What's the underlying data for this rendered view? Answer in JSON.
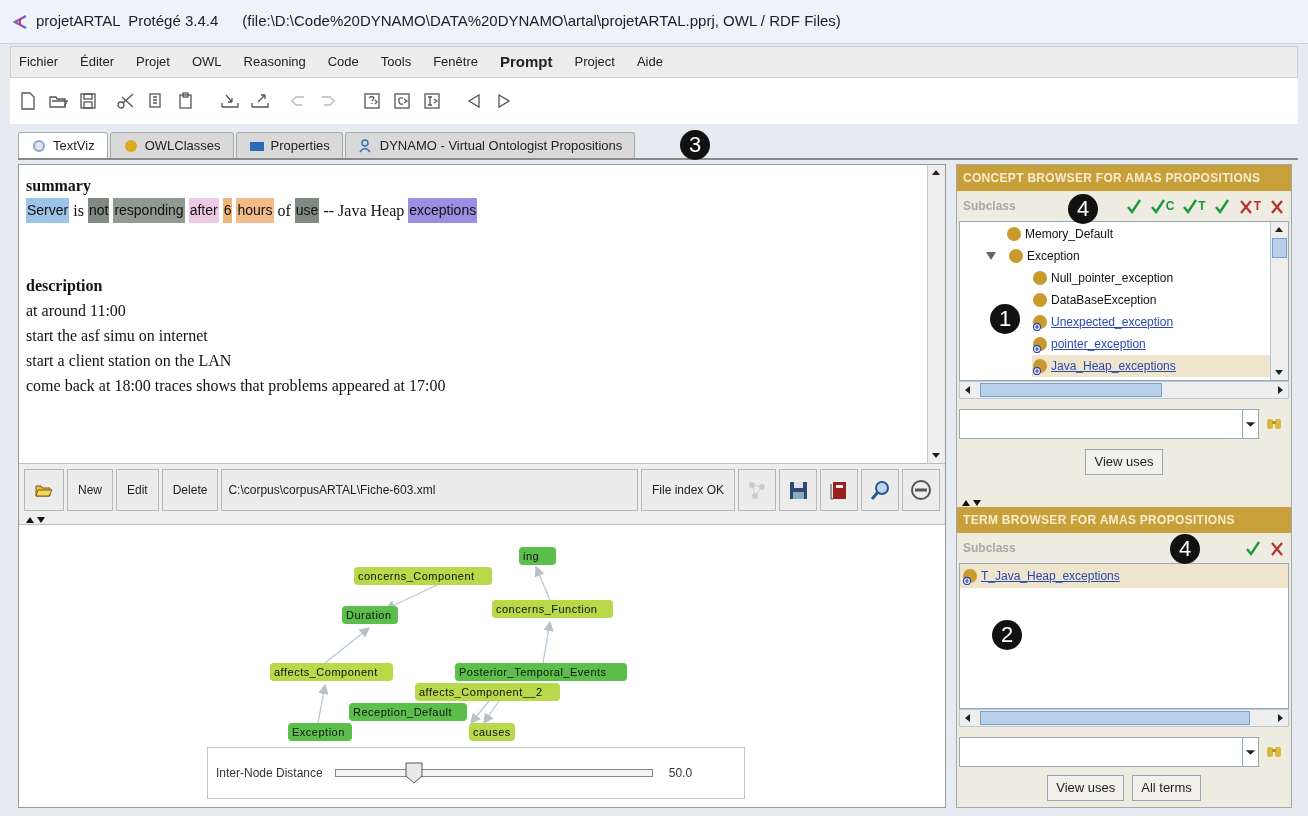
{
  "window": {
    "title": "projetARTAL  Protégé 3.4.4",
    "file": "(file:\\D:\\Code%20DYNAMO\\DATA%20DYNAMO\\artal\\projetARTAL.pprj, OWL / RDF Files)"
  },
  "menu": [
    {
      "label": "Fichier",
      "emphasized": false
    },
    {
      "label": "Éditer",
      "emphasized": false
    },
    {
      "label": "Projet",
      "emphasized": false
    },
    {
      "label": "OWL",
      "emphasized": false
    },
    {
      "label": "Reasoning",
      "emphasized": false
    },
    {
      "label": "Code",
      "emphasized": false
    },
    {
      "label": "Tools",
      "emphasized": false
    },
    {
      "label": "Fenêtre",
      "emphasized": false
    },
    {
      "label": "Prompt",
      "emphasized": true
    },
    {
      "label": "Project",
      "emphasized": false
    },
    {
      "label": "Aide",
      "emphasized": false
    }
  ],
  "tabs": [
    {
      "label": "TextViz",
      "kind": "textviz",
      "selected": true
    },
    {
      "label": "OWLClasses",
      "kind": "classes",
      "selected": false
    },
    {
      "label": "Properties",
      "kind": "properties",
      "selected": false
    },
    {
      "label": "DYNAMO - Virtual Ontologist Propositions",
      "kind": "dynamo",
      "selected": false
    }
  ],
  "document": {
    "summary_heading": "summary",
    "summary_tokens": [
      {
        "text": "Server",
        "color": "#9cc3e8"
      },
      {
        "text": "is"
      },
      {
        "text": "not",
        "color": "#7f8a82"
      },
      {
        "text": "responding",
        "color": "#8f9a90"
      },
      {
        "text": "after",
        "color": "#ecc9e4"
      },
      {
        "text": "6",
        "color": "#f0b37a"
      },
      {
        "text": "hours",
        "color": "#f2bb8a"
      },
      {
        "text": "of"
      },
      {
        "text": "use",
        "color": "#7f8a82"
      },
      {
        "text": "-- Java Heap"
      },
      {
        "text": "exceptions",
        "color": "#9a8fe2"
      }
    ],
    "description_heading": "description",
    "description_lines": [
      "at around 11:00",
      "start the asf simu on internet",
      "start a client station on the LAN",
      "come back at 18:00 traces shows that problems appeared at 17:00"
    ]
  },
  "file_bar": {
    "buttons": [
      "New",
      "Edit",
      "Delete"
    ],
    "path": "C:\\corpus\\corpusARTAL\\Fiche-603.xml",
    "status_button": "File index OK"
  },
  "graph": {
    "nodes": [
      {
        "label": "ing",
        "kind": "concept"
      },
      {
        "label": "concerns_Component",
        "kind": "relation"
      },
      {
        "label": "Duration",
        "kind": "concept"
      },
      {
        "label": "concerns_Function",
        "kind": "relation"
      },
      {
        "label": "affects_Component",
        "kind": "relation"
      },
      {
        "label": "Posterior_Temporal_Events",
        "kind": "concept"
      },
      {
        "label": "affects_Component__2",
        "kind": "relation"
      },
      {
        "label": "Reception_Default",
        "kind": "concept"
      },
      {
        "label": "causes",
        "kind": "relation"
      },
      {
        "label": "Exception",
        "kind": "concept"
      }
    ]
  },
  "slider": {
    "label": "Inter-Node Distance",
    "level": 0.25,
    "reading": "50.0"
  },
  "concept_browser": {
    "title": "CONCEPT BROWSER FOR AMAS PROPOSITIONS",
    "subtitle": "Subclass",
    "actions": [
      {
        "kind": "accept"
      },
      {
        "kind": "accept",
        "label": "C"
      },
      {
        "kind": "accept",
        "label": "T"
      },
      {
        "kind": "accept"
      },
      {
        "kind": "reject",
        "label": "T"
      },
      {
        "kind": "reject"
      }
    ],
    "tree": [
      {
        "label": "Memory_Default",
        "kind": "class",
        "expanded": false,
        "selected": false
      },
      {
        "label": "Exception",
        "kind": "class",
        "expanded": true,
        "selected": false,
        "children": [
          {
            "label": "Null_pointer_exception",
            "kind": "class",
            "selected": false
          },
          {
            "label": "DataBaseException",
            "kind": "class",
            "selected": false
          },
          {
            "label": "Unexpected_exception",
            "kind": "proposition",
            "selected": false
          },
          {
            "label": "pointer_exception",
            "kind": "proposition",
            "selected": false
          },
          {
            "label": "Java_Heap_exceptions",
            "kind": "proposition",
            "selected": true
          }
        ]
      }
    ],
    "button": "View uses"
  },
  "term_browser": {
    "title": "TERM BROWSER FOR AMAS PROPOSITIONS",
    "subtitle": "Subclass",
    "actions": [
      {
        "kind": "accept"
      },
      {
        "kind": "reject"
      }
    ],
    "items": [
      {
        "label": "T_Java_Heap_exceptions",
        "kind": "proposition",
        "selected": true
      }
    ],
    "buttons": [
      "View uses",
      "All terms"
    ]
  },
  "callouts": [
    {
      "label": "3"
    },
    {
      "label": "4"
    },
    {
      "label": "1"
    },
    {
      "label": "4"
    },
    {
      "label": "2"
    }
  ]
}
